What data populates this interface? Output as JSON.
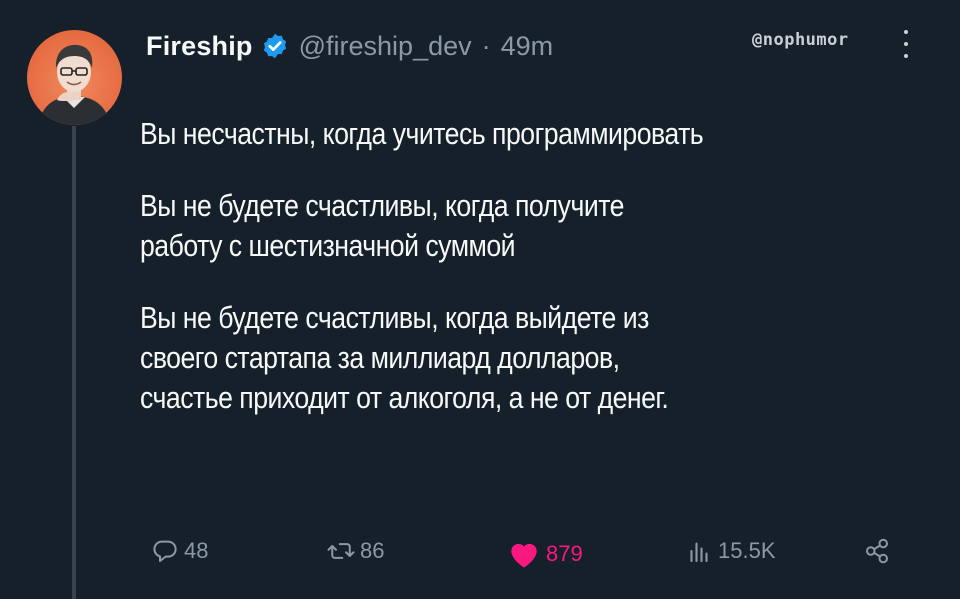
{
  "tweet": {
    "display_name": "Fireship",
    "handle": "@fireship_dev",
    "separator": "·",
    "time": "49m",
    "verified": true,
    "paragraphs": [
      [
        "Вы несчастны, когда учитесь программировать"
      ],
      [
        "Вы не будете счастливы, когда получите",
        "работу с шестизначной суммой"
      ],
      [
        "Вы не будете счастливы, когда выйдете из",
        "своего стартапа за миллиард долларов,",
        "счастье приходит от алкоголя, а не от денег."
      ]
    ]
  },
  "watermark": "@nophumor",
  "actions": {
    "replies": "48",
    "retweets": "86",
    "likes": "879",
    "views": "15.5K"
  },
  "icons": {
    "reply": "reply-icon",
    "retweet": "retweet-icon",
    "like": "heart-icon",
    "views": "views-icon",
    "share": "share-icon",
    "more": "more-icon",
    "verified": "verified-badge-icon"
  },
  "colors": {
    "background": "#15202b",
    "text": "#f7f9f9",
    "muted": "#8b98a5",
    "verified": "#1d9bf0",
    "like": "#f91880",
    "avatar_bg": "#e86f45"
  }
}
